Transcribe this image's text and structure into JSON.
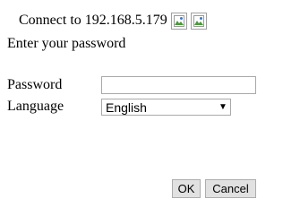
{
  "dialog": {
    "title": "Connect to 192.168.5.179",
    "instruction": "Enter your password"
  },
  "form": {
    "password_label": "Password",
    "password_value": "",
    "language_label": "Language",
    "language_selected": "English"
  },
  "buttons": {
    "ok_label": "OK",
    "cancel_label": "Cancel"
  },
  "icons": {
    "image_1": "broken-image-icon",
    "image_2": "broken-image-icon",
    "dropdown": "dropdown-arrow-icon"
  }
}
